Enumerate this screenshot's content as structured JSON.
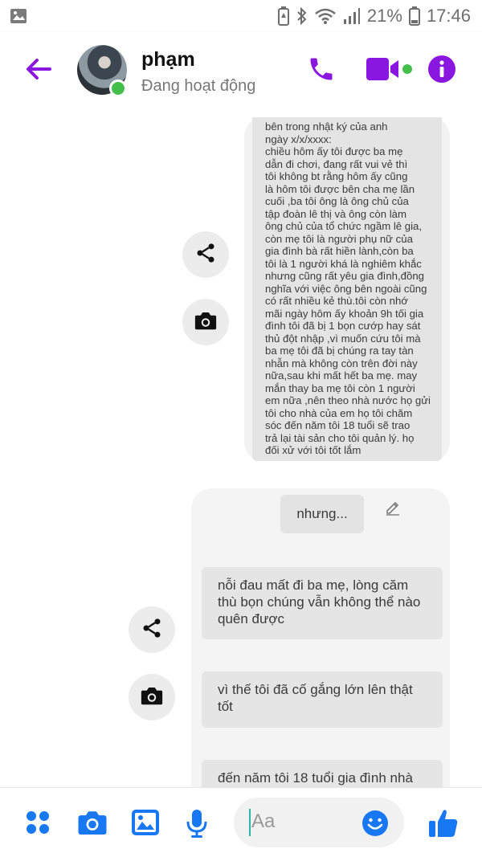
{
  "status_bar": {
    "battery_percent": "21%",
    "time": "17:46"
  },
  "header": {
    "contact_name": "phạm",
    "contact_status": "Đang hoạt động"
  },
  "messages": {
    "long_text": "bên trong nhật ký của anh\nngày x/x/xxxx:\nchiều hôm ấy tôi được ba mẹ\ndẫn đi chơi, đang rất vui vẻ thì\ntôi không bt rằng hôm ấy cũng\nlà hôm tôi được bên cha mẹ lần\ncuối ,ba tôi ông là ông chủ của\ntập đoàn lê thị và ông còn làm\nông chủ của tổ chức ngầm lê gia,\ncòn mẹ tôi là người phụ nữ của\ngia đình bà rất hiền lành,còn ba\ntôi là 1 người khá là nghiêm khắc\nnhưng cũng rất yêu gia đình,đồng\nnghĩa với việc ông bên ngoài cũng\ncó rất nhiều kẻ thù.tôi còn nhớ\nmãi ngày hôm ấy  khoản 9h tối gia\nđình tôi đã bị 1 bọn cướp hay sát\nthủ đột nhập ,vì muốn cứu tôi mà\nba mẹ tôi đã bị chúng ra tay tàn\nnhẫn mà không còn trên đời này\nnữa,sau khi mất hết ba mẹ. may\nmắn thay ba mẹ tôi còn 1 người\nem nữa ,nên theo nhà nước họ gửi\ntôi cho nhà của em họ tôi chăm\nsóc đến năm tôi 18 tuổi sẽ trao\ntrả lại tài sản cho tôi quản lý. họ\nđối xử với tôi tốt lắm",
    "short_text": "nhưng...",
    "message_2": "nỗi đau mất đi ba mẹ, lòng căm thù bọn chúng vẫn không thể nào quên được",
    "message_3": "vì thế tôi đã cố gắng lớn lên thật tốt",
    "message_4": "đến năm tôi 18 tuổi gia đình nhà"
  },
  "composer": {
    "placeholder": "Aa"
  },
  "colors": {
    "accent": "#8a17e0",
    "composer_blue": "#1877f2",
    "online_green": "#44c04a"
  },
  "icons": [
    "image-icon",
    "battery-saver-icon",
    "bluetooth-icon",
    "wifi-icon",
    "signal-icon",
    "battery-icon",
    "back-arrow-icon",
    "phone-icon",
    "video-icon",
    "info-icon",
    "share-icon",
    "camera-icon",
    "pencil-icon",
    "apps-icon",
    "gallery-icon",
    "microphone-icon",
    "emoji-icon",
    "thumbs-up-icon"
  ]
}
